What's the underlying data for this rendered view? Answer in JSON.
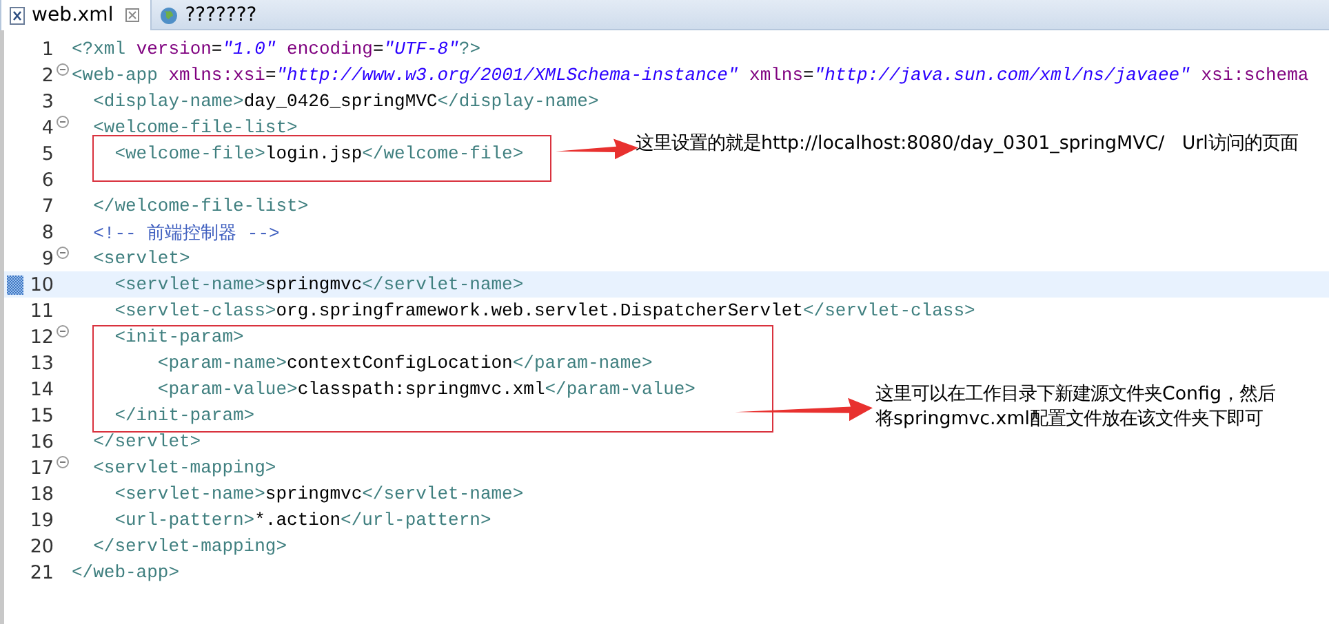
{
  "tabs": [
    {
      "label": "web.xml",
      "kind": "xml",
      "selected": true,
      "closable": true
    },
    {
      "label": "???????",
      "kind": "web",
      "selected": false,
      "closable": false
    }
  ],
  "editor": {
    "lines": [
      {
        "number": "1",
        "foldable": false,
        "current": false,
        "tokens": [
          {
            "kind": "tag",
            "text": "<?xml "
          },
          {
            "kind": "attr",
            "text": "version"
          },
          {
            "kind": "text",
            "text": "="
          },
          {
            "kind": "value",
            "text": "\"1.0\" "
          },
          {
            "kind": "attr",
            "text": "encoding"
          },
          {
            "kind": "text",
            "text": "="
          },
          {
            "kind": "value",
            "text": "\"UTF-8\""
          },
          {
            "kind": "tag",
            "text": "?>"
          }
        ]
      },
      {
        "number": "2",
        "foldable": true,
        "current": false,
        "tokens": [
          {
            "kind": "tag",
            "text": "<web-app "
          },
          {
            "kind": "attr",
            "text": "xmlns:xsi"
          },
          {
            "kind": "text",
            "text": "="
          },
          {
            "kind": "value",
            "text": "\"http://www.w3.org/2001/XMLSchema-instance\" "
          },
          {
            "kind": "attr",
            "text": "xmlns"
          },
          {
            "kind": "text",
            "text": "="
          },
          {
            "kind": "value",
            "text": "\"http://java.sun.com/xml/ns/javaee\" "
          },
          {
            "kind": "attr",
            "text": "xsi:schema"
          }
        ],
        "children": [
          {
            "number": "3",
            "foldable": false,
            "current": false,
            "tokens": [
              {
                "kind": "tag",
                "text": "<display-name>"
              },
              {
                "kind": "text",
                "text": "day_0426_springMVC"
              },
              {
                "kind": "tag",
                "text": "</display-name>"
              }
            ]
          },
          {
            "number": "4",
            "foldable": true,
            "current": false,
            "tokens": [
              {
                "kind": "tag",
                "text": "<welcome-file-list>"
              }
            ],
            "children": [
              {
                "number": "5",
                "foldable": false,
                "current": false,
                "tokens": [
                  {
                    "kind": "tag",
                    "text": "<welcome-file>"
                  },
                  {
                    "kind": "text",
                    "text": "login.jsp"
                  },
                  {
                    "kind": "tag",
                    "text": "</welcome-file>"
                  }
                ]
              },
              {
                "number": "6",
                "foldable": false,
                "current": false
              }
            ]
          },
          {
            "number": "7",
            "foldable": false,
            "current": false,
            "tokens": [
              {
                "kind": "tag",
                "text": "</welcome-file-list>"
              }
            ]
          },
          {
            "number": "8",
            "foldable": false,
            "current": false,
            "tokens": [
              {
                "kind": "comment",
                "text": "<!-- 前端控制器 -->"
              }
            ]
          },
          {
            "number": "9",
            "foldable": true,
            "current": false,
            "tokens": [
              {
                "kind": "tag",
                "text": "<servlet>"
              }
            ],
            "children": [
              {
                "number": "10",
                "foldable": false,
                "current": true,
                "tokens": [
                  {
                    "kind": "tag",
                    "text": "<servlet-name>"
                  },
                  {
                    "kind": "text",
                    "text": "springmvc"
                  },
                  {
                    "kind": "tag",
                    "text": "</servlet-name>"
                  }
                ]
              },
              {
                "number": "11",
                "foldable": false,
                "current": false,
                "tokens": [
                  {
                    "kind": "tag",
                    "text": "<servlet-class>"
                  },
                  {
                    "kind": "text",
                    "text": "org.springframework.web.servlet.DispatcherServlet"
                  },
                  {
                    "kind": "tag",
                    "text": "</servlet-class>"
                  }
                ]
              },
              {
                "number": "12",
                "foldable": true,
                "current": false,
                "tokens": [
                  {
                    "kind": "tag",
                    "text": "<init-param>"
                  }
                ],
                "children": [
                  {
                    "number": "13",
                    "foldable": false,
                    "current": false,
                    "tokens": [
                      {
                        "kind": "tag",
                        "text": "<param-name>"
                      },
                      {
                        "kind": "text",
                        "text": "contextConfigLocation"
                      },
                      {
                        "kind": "tag",
                        "text": "</param-name>"
                      }
                    ]
                  },
                  {
                    "number": "14",
                    "foldable": false,
                    "current": false,
                    "tokens": [
                      {
                        "kind": "tag",
                        "text": "<param-value>"
                      },
                      {
                        "kind": "text",
                        "text": "classpath:springmvc.xml"
                      },
                      {
                        "kind": "tag",
                        "text": "</param-value>"
                      }
                    ]
                  }
                ]
              },
              {
                "number": "15",
                "foldable": false,
                "current": false,
                "tokens": [
                  {
                    "kind": "tag",
                    "text": "</init-param>"
                  }
                ]
              }
            ]
          },
          {
            "number": "16",
            "foldable": false,
            "current": false,
            "tokens": [
              {
                "kind": "tag",
                "text": "</servlet>"
              }
            ]
          },
          {
            "number": "17",
            "foldable": true,
            "current": false,
            "tokens": [
              {
                "kind": "tag",
                "text": "<servlet-mapping>"
              }
            ],
            "children": [
              {
                "number": "18",
                "foldable": false,
                "current": false,
                "tokens": [
                  {
                    "kind": "tag",
                    "text": "<servlet-name>"
                  },
                  {
                    "kind": "text",
                    "text": "springmvc"
                  },
                  {
                    "kind": "tag",
                    "text": "</servlet-name>"
                  }
                ]
              },
              {
                "number": "19",
                "foldable": false,
                "current": false,
                "tokens": [
                  {
                    "kind": "tag",
                    "text": "<url-pattern>"
                  },
                  {
                    "kind": "text",
                    "text": "*.action"
                  },
                  {
                    "kind": "tag",
                    "text": "</url-pattern>"
                  }
                ]
              }
            ]
          },
          {
            "number": "20",
            "foldable": false,
            "current": false,
            "tokens": [
              {
                "kind": "tag",
                "text": "</servlet-mapping>"
              }
            ]
          }
        ]
      },
      {
        "number": "21",
        "foldable": false,
        "current": false,
        "tokens": [
          {
            "kind": "tag",
            "text": "</web-app>"
          }
        ]
      }
    ]
  },
  "annotations": [
    {
      "lines": [
        "这里设置的就是http://localhost:8080/day_0301_springMVC/   Url访问的页面"
      ]
    },
    {
      "lines": [
        "这里可以在工作目录下新建源文件夹Config，然后",
        "将springmvc.xml配置文件放在该文件夹下即可"
      ]
    }
  ]
}
